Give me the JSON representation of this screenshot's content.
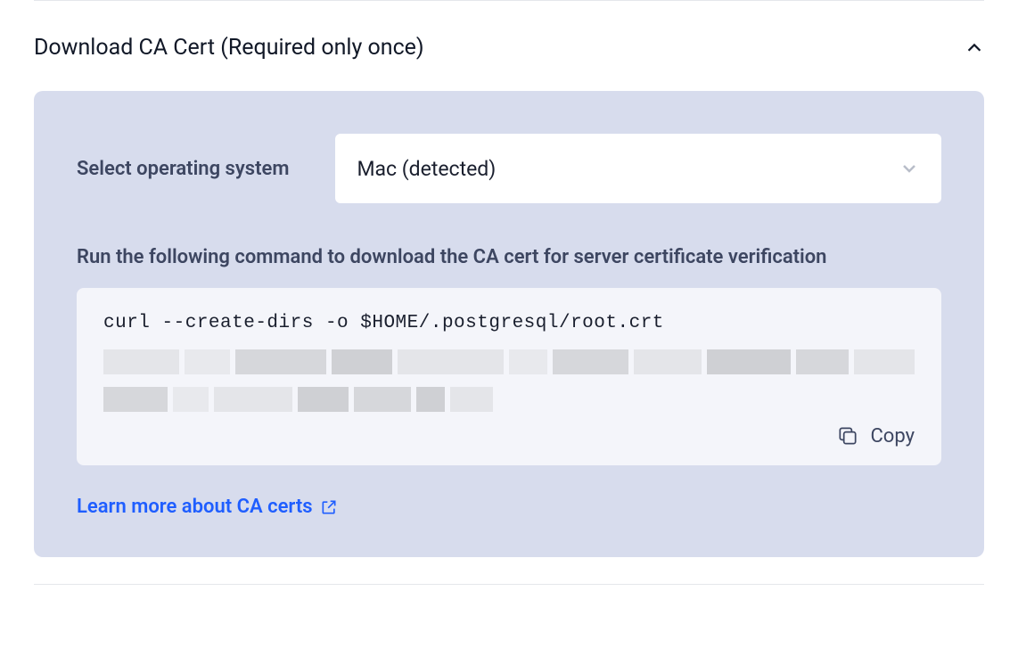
{
  "section": {
    "title": "Download CA Cert (Required only once)"
  },
  "panel": {
    "os_label": "Select operating system",
    "os_selected": "Mac (detected)",
    "instruction": "Run the following command to download the CA cert for server certificate verification",
    "command": "curl --create-dirs -o $HOME/.postgresql/root.crt",
    "copy_label": "Copy",
    "learn_more_label": "Learn more about CA certs"
  }
}
